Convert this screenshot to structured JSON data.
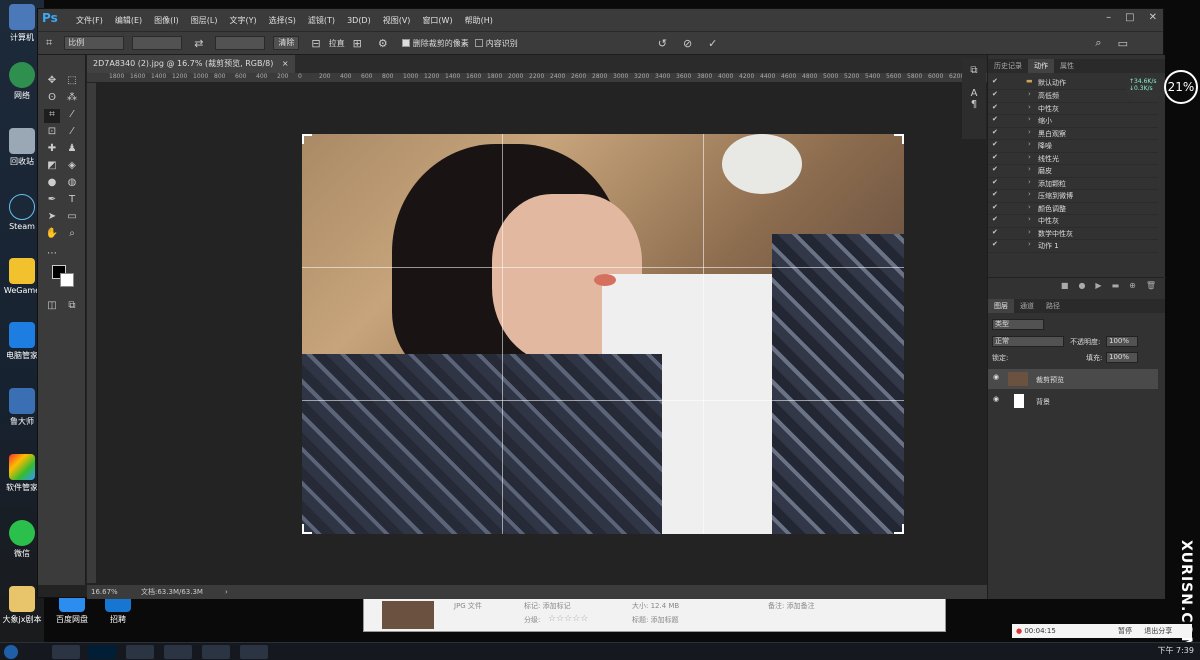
{
  "desktop_icons": [
    {
      "label": "计算机"
    },
    {
      "label": "网络"
    },
    {
      "label": "回收站"
    },
    {
      "label": "Steam"
    },
    {
      "label": "WeGame"
    },
    {
      "label": "电脑管家"
    },
    {
      "label": "鲁大师"
    },
    {
      "label": "软件管家"
    },
    {
      "label": "微信"
    },
    {
      "label": "大象jx剧本"
    },
    {
      "label": "百度网盘"
    },
    {
      "label": "招聘"
    }
  ],
  "menubar": {
    "logo": "Ps",
    "items": [
      "文件(F)",
      "编辑(E)",
      "图像(I)",
      "图层(L)",
      "文字(Y)",
      "选择(S)",
      "滤镜(T)",
      "3D(D)",
      "视图(V)",
      "窗口(W)",
      "帮助(H)"
    ]
  },
  "options": {
    "ratio_label": "比例",
    "clear_btn": "清除",
    "straighten_btn": "拉直",
    "delete_pixels_label": "删除裁剪的像素",
    "content_aware_label": "内容识别",
    "delete_pixels_checked": true,
    "content_aware_checked": false
  },
  "document": {
    "tab_title": "2D7A8340 (2).jpg @ 16.7% (裁剪预览, RGB/8)",
    "ruler_ticks": [
      "1800",
      "1600",
      "1400",
      "1200",
      "1000",
      "800",
      "600",
      "400",
      "200",
      "0",
      "200",
      "400",
      "600",
      "800",
      "1000",
      "1200",
      "1400",
      "1600",
      "1800",
      "2000",
      "2200",
      "2400",
      "2600",
      "2800",
      "3000",
      "3200",
      "3400",
      "3600",
      "3800",
      "4000",
      "4200",
      "4400",
      "4600",
      "4800",
      "5000",
      "5200",
      "5400",
      "5600",
      "5800",
      "6000",
      "6200",
      "6400"
    ],
    "zoom": "16.67%",
    "doc_size": "文档:63.3M/63.3M"
  },
  "history_panel": {
    "tabs": [
      "历史记录",
      "动作",
      "属性"
    ],
    "active_tab": "动作",
    "set_name": "默认动作",
    "actions": [
      "高低频",
      "中性灰",
      "缩小",
      "黑白观察",
      "降噪",
      "线性光",
      "磨皮",
      "添加颗粒",
      "压缩到微博",
      "颜色调整",
      "中性灰",
      "数学中性灰",
      "动作 1"
    ]
  },
  "layers_panel": {
    "tabs": [
      "图层",
      "通道",
      "路径"
    ],
    "active_tab": "图层",
    "kind_label": "类型",
    "blend_mode": "正常",
    "opacity_label": "不透明度:",
    "opacity_value": "100%",
    "lock_label": "锁定:",
    "fill_label": "填充:",
    "fill_value": "100%",
    "layers": [
      {
        "name": "裁剪预览",
        "selected": true
      },
      {
        "name": "背景",
        "selected": false
      }
    ]
  },
  "library": {
    "type_label": "JPG 文件",
    "tag_label": "标记: 添加标记",
    "rating_label": "分级:",
    "size_label": "大小: 12.4 MB",
    "title_label": "标题: 添加标题",
    "note_label": "备注: 添加备注"
  },
  "recorder": {
    "time": "00:04:15",
    "pause": "暂停",
    "exit": "退出分享"
  },
  "network": {
    "up": "↑34.6K/s",
    "down": "↓0.3K/s",
    "percent": "21%"
  },
  "watermark": "XURISN.COM",
  "clock": {
    "time": "下午 7:39"
  }
}
